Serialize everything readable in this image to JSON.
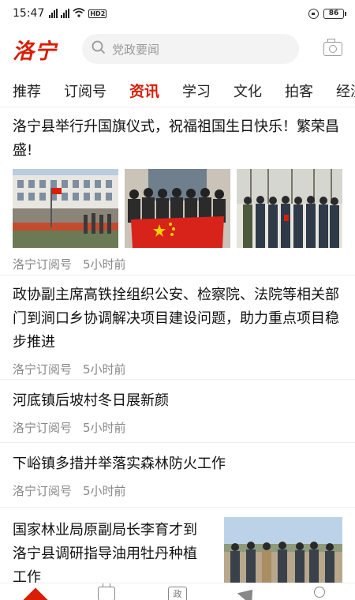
{
  "status": {
    "time": "15:47",
    "network": "HD2",
    "battery": "86"
  },
  "header": {
    "logo": "洛宁",
    "search_placeholder": "党政要闻"
  },
  "tabs": [
    {
      "label": "推荐"
    },
    {
      "label": "订阅号"
    },
    {
      "label": "资讯"
    },
    {
      "label": "学习"
    },
    {
      "label": "文化"
    },
    {
      "label": "拍客"
    },
    {
      "label": "经济"
    }
  ],
  "active_tab": "资讯",
  "articles": [
    {
      "title": "洛宁县举行升国旗仪式，祝福祖国生日快乐！繁荣昌盛!",
      "source": "洛宁订阅号",
      "time": "5小时前"
    },
    {
      "title": "政协副主席高铁拴组织公安、检察院、法院等相关部门到涧口乡协调解决项目建设问题，助力重点项目稳步推进",
      "source": "洛宁订阅号",
      "time": "5小时前"
    },
    {
      "title": "河底镇后坡村冬日展新颜",
      "source": "洛宁订阅号",
      "time": "5小时前"
    },
    {
      "title": "下峪镇多措并举落实森林防火工作",
      "source": "洛宁订阅号",
      "time": "5小时前"
    },
    {
      "title": "国家林业局原副局长李育才到洛宁县调研指导油用牡丹种植工作"
    }
  ],
  "colors": {
    "accent": "#d81e06",
    "meta_text": "#888888"
  },
  "bottom_nav": [
    {
      "icon": "home-icon"
    },
    {
      "icon": "tv-icon"
    },
    {
      "icon": "zheng-icon",
      "label": "政"
    },
    {
      "icon": "send-icon"
    },
    {
      "icon": "user-icon"
    }
  ]
}
